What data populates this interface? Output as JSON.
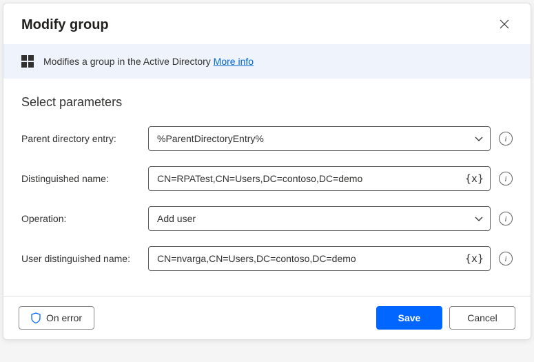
{
  "dialog": {
    "title": "Modify group",
    "banner_text": "Modifies a group in the Active Directory ",
    "more_info": "More info",
    "section_title": "Select parameters"
  },
  "fields": {
    "parent_entry": {
      "label": "Parent directory entry:",
      "value": "%ParentDirectoryEntry%"
    },
    "distinguished_name": {
      "label": "Distinguished name:",
      "value": "CN=RPATest,CN=Users,DC=contoso,DC=demo",
      "var_token": "{x}"
    },
    "operation": {
      "label": "Operation:",
      "value": "Add user"
    },
    "user_dn": {
      "label": "User distinguished name:",
      "value": "CN=nvarga,CN=Users,DC=contoso,DC=demo",
      "var_token": "{x}"
    }
  },
  "footer": {
    "on_error": "On error",
    "save": "Save",
    "cancel": "Cancel"
  },
  "info_char": "i"
}
